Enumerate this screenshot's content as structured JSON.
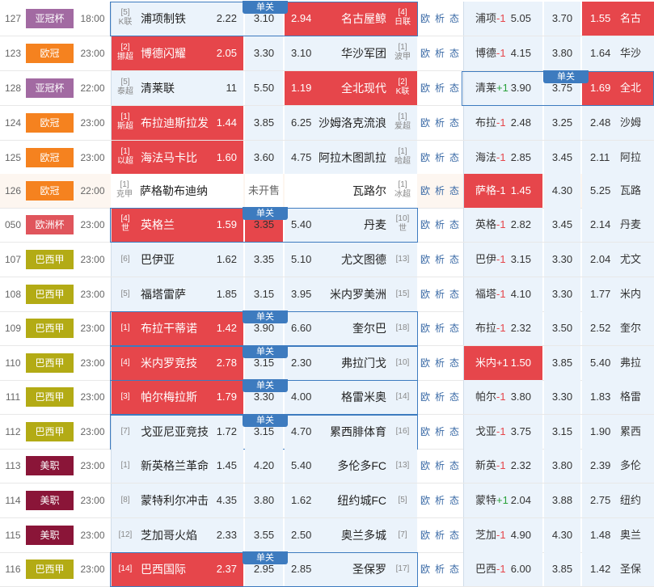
{
  "danguan_label": "单关",
  "links": [
    "欧",
    "析",
    "态"
  ],
  "colors": {
    "selected": "#e6464b",
    "cell_bg": "#ebf3fb",
    "frame": "#3d7bbf"
  },
  "rows": [
    {
      "num": "127",
      "league": "亚冠杯",
      "lc": "l-yg",
      "time": "18:00",
      "hr": "[5]\nK联",
      "home": "浦项制铁",
      "ho": "2.22",
      "d": "3.10",
      "ao": "2.94",
      "away": "名古屋鲸",
      "ar": "[4]\n日联",
      "sel": "a",
      "ahl": "浦项",
      "ah": "-1",
      "aho": "5.05",
      "ahd": "3.70",
      "ahao": "1.55",
      "ahaw": "名古",
      "ahsel": "a",
      "frame": true,
      "badgeCol": "c"
    },
    {
      "num": "123",
      "league": "欧冠",
      "lc": "l-oc",
      "time": "23:00",
      "hr": "[2]\n挪超",
      "home": "博德闪耀",
      "ho": "2.05",
      "d": "3.30",
      "ao": "3.10",
      "away": "华沙军团",
      "ar": "[1]\n波甲",
      "sel": "h",
      "ahl": "博德",
      "ah": "-1",
      "aho": "4.15",
      "ahd": "3.80",
      "ahao": "1.64",
      "ahaw": "华沙",
      "ahsel": ""
    },
    {
      "num": "128",
      "league": "亚冠杯",
      "lc": "l-yg",
      "time": "22:00",
      "hr": "[5]\n泰超",
      "home": "清莱联",
      "ho": "11",
      "d": "5.50",
      "ao": "1.19",
      "away": "全北现代",
      "ar": "[2]\nK联",
      "sel": "a",
      "ahl": "清莱",
      "ah": "+1",
      "aho": "3.90",
      "ahd": "3.75",
      "ahao": "1.69",
      "ahaw": "全北",
      "ahsel": "a",
      "ahframe": true
    },
    {
      "num": "124",
      "league": "欧冠",
      "lc": "l-oc",
      "time": "23:00",
      "hr": "[1]\n斯超",
      "home": "布拉迪斯拉发",
      "ho": "1.44",
      "d": "3.85",
      "ao": "6.25",
      "away": "沙姆洛克流浪",
      "ar": "[1]\n爱超",
      "sel": "h",
      "ahl": "布拉",
      "ah": "-1",
      "aho": "2.48",
      "ahd": "3.25",
      "ahao": "2.48",
      "ahaw": "沙姆",
      "ahsel": ""
    },
    {
      "num": "125",
      "league": "欧冠",
      "lc": "l-oc",
      "time": "23:00",
      "hr": "[1]\n以超",
      "home": "海法马卡比",
      "ho": "1.60",
      "d": "3.60",
      "ao": "4.75",
      "away": "阿拉木图凯拉",
      "ar": "[1]\n哈超",
      "sel": "h",
      "ahl": "海法",
      "ah": "-1",
      "aho": "2.85",
      "ahd": "3.45",
      "ahao": "2.11",
      "ahaw": "阿拉",
      "ahsel": ""
    },
    {
      "num": "126",
      "league": "欧冠",
      "lc": "l-oc",
      "time": "22:00",
      "hr": "[1]\n克甲",
      "home": "萨格勒布迪纳",
      "ho": "",
      "d": "未开售",
      "ao": "",
      "away": "瓦路尔",
      "ar": "[1]\n冰超",
      "sel": "",
      "ahl": "萨格",
      "ah": "-1",
      "aho": "1.45",
      "ahd": "4.30",
      "ahao": "5.25",
      "ahaw": "瓦路",
      "ahsel": "h",
      "nosale": true
    },
    {
      "num": "050",
      "league": "欧洲杯",
      "lc": "l-oz",
      "time": "23:00",
      "hr": "[4]\n世",
      "home": "英格兰",
      "ho": "1.59",
      "d": "3.35",
      "ao": "5.40",
      "away": "丹麦",
      "ar": "[10]\n世",
      "sel": "hd",
      "ahl": "英格",
      "ah": "-1",
      "aho": "2.82",
      "ahd": "3.45",
      "ahao": "2.14",
      "ahaw": "丹麦",
      "ahsel": "",
      "frame": true,
      "badgeCol": "c"
    },
    {
      "num": "107",
      "league": "巴西甲",
      "lc": "l-bx",
      "time": "23:00",
      "hr": "[6]",
      "home": "巴伊亚",
      "ho": "1.62",
      "d": "3.35",
      "ao": "5.10",
      "away": "尤文图德",
      "ar": "[13]",
      "sel": "",
      "ahl": "巴伊",
      "ah": "-1",
      "aho": "3.15",
      "ahd": "3.30",
      "ahao": "2.04",
      "ahaw": "尤文",
      "ahsel": ""
    },
    {
      "num": "108",
      "league": "巴西甲",
      "lc": "l-bx",
      "time": "23:00",
      "hr": "[5]",
      "home": "福塔雷萨",
      "ho": "1.85",
      "d": "3.15",
      "ao": "3.95",
      "away": "米内罗美洲",
      "ar": "[15]",
      "sel": "",
      "ahl": "福塔",
      "ah": "-1",
      "aho": "4.10",
      "ahd": "3.30",
      "ahao": "1.77",
      "ahaw": "米内",
      "ahsel": ""
    },
    {
      "num": "109",
      "league": "巴西甲",
      "lc": "l-bx",
      "time": "23:00",
      "hr": "[1]",
      "home": "布拉干蒂诺",
      "ho": "1.42",
      "d": "3.90",
      "ao": "6.60",
      "away": "奎尔巴",
      "ar": "[18]",
      "sel": "h",
      "ahl": "布拉",
      "ah": "-1",
      "aho": "2.32",
      "ahd": "3.50",
      "ahao": "2.52",
      "ahaw": "奎尔",
      "ahsel": "",
      "frame": true,
      "badgeCol": "c"
    },
    {
      "num": "110",
      "league": "巴西甲",
      "lc": "l-bx",
      "time": "23:00",
      "hr": "[4]",
      "home": "米内罗竞技",
      "ho": "2.78",
      "d": "3.15",
      "ao": "2.30",
      "away": "弗拉门戈",
      "ar": "[10]",
      "sel": "h",
      "ahl": "米内",
      "ah": "+1",
      "aho": "1.50",
      "ahd": "3.85",
      "ahao": "5.40",
      "ahaw": "弗拉",
      "ahsel": "h",
      "frame": true,
      "badgeCol": "c"
    },
    {
      "num": "111",
      "league": "巴西甲",
      "lc": "l-bx",
      "time": "23:00",
      "hr": "[3]",
      "home": "帕尔梅拉斯",
      "ho": "1.79",
      "d": "3.30",
      "ao": "4.00",
      "away": "格雷米奥",
      "ar": "[14]",
      "sel": "h",
      "ahl": "帕尔",
      "ah": "-1",
      "aho": "3.80",
      "ahd": "3.30",
      "ahao": "1.83",
      "ahaw": "格雷",
      "ahsel": "",
      "frame": true,
      "badgeCol": "c"
    },
    {
      "num": "112",
      "league": "巴西甲",
      "lc": "l-bx",
      "time": "23:00",
      "hr": "[7]",
      "home": "戈亚尼亚竞技",
      "ho": "1.72",
      "d": "3.15",
      "ao": "4.70",
      "away": "累西腓体育",
      "ar": "[16]",
      "sel": "",
      "ahl": "戈亚",
      "ah": "-1",
      "aho": "3.75",
      "ahd": "3.15",
      "ahao": "1.90",
      "ahaw": "累西",
      "ahsel": "",
      "frame": true,
      "badgeCol": "c"
    },
    {
      "num": "113",
      "league": "美职",
      "lc": "l-mz",
      "time": "23:00",
      "hr": "[1]",
      "home": "新英格兰革命",
      "ho": "1.45",
      "d": "4.20",
      "ao": "5.40",
      "away": "多伦多FC",
      "ar": "[13]",
      "sel": "",
      "ahl": "新英",
      "ah": "-1",
      "aho": "2.32",
      "ahd": "3.80",
      "ahao": "2.39",
      "ahaw": "多伦",
      "ahsel": ""
    },
    {
      "num": "114",
      "league": "美职",
      "lc": "l-mz",
      "time": "23:00",
      "hr": "[8]",
      "home": "蒙特利尔冲击",
      "ho": "4.35",
      "d": "3.80",
      "ao": "1.62",
      "away": "纽约城FC",
      "ar": "[5]",
      "sel": "",
      "ahl": "蒙特",
      "ah": "+1",
      "aho": "2.04",
      "ahd": "3.88",
      "ahao": "2.75",
      "ahaw": "纽约",
      "ahsel": ""
    },
    {
      "num": "115",
      "league": "美职",
      "lc": "l-mz",
      "time": "23:00",
      "hr": "[12]",
      "home": "芝加哥火焰",
      "ho": "2.33",
      "d": "3.55",
      "ao": "2.50",
      "away": "奥兰多城",
      "ar": "[7]",
      "sel": "",
      "ahl": "芝加",
      "ah": "-1",
      "aho": "4.90",
      "ahd": "4.30",
      "ahao": "1.48",
      "ahaw": "奥兰",
      "ahsel": ""
    },
    {
      "num": "116",
      "league": "巴西甲",
      "lc": "l-bx",
      "time": "23:00",
      "hr": "[14]",
      "home": "巴西国际",
      "ho": "2.37",
      "d": "2.95",
      "ao": "2.85",
      "away": "圣保罗",
      "ar": "[17]",
      "sel": "h",
      "ahl": "巴西",
      "ah": "-1",
      "aho": "6.00",
      "ahd": "3.85",
      "ahao": "1.42",
      "ahaw": "圣保",
      "ahsel": "",
      "frame": true,
      "badgeCol": "c"
    }
  ]
}
